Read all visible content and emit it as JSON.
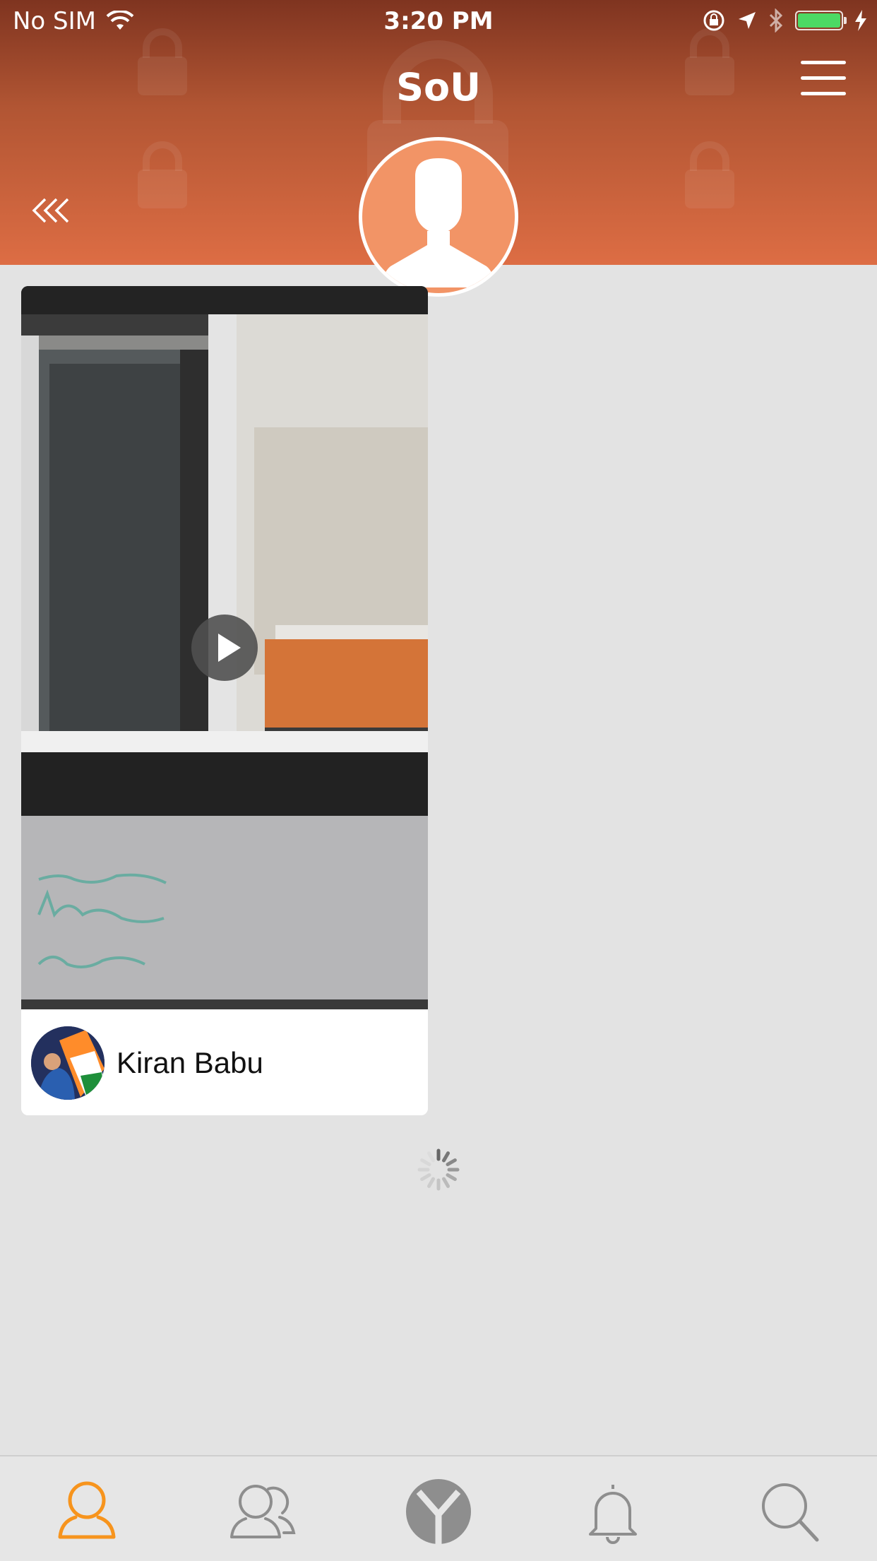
{
  "status_bar": {
    "carrier": "No SIM",
    "time": "3:20 PM",
    "battery_color": "#4cd964"
  },
  "header": {
    "title": "SoU",
    "gradient_colors": [
      "#7f3420",
      "#dd6d44"
    ],
    "back_icon": "double-chevron-left-icon",
    "menu_icon": "hamburger-menu-icon"
  },
  "profile": {
    "avatar_icon": "default-user-silhouette-icon",
    "avatar_color": "#f29466"
  },
  "feed": {
    "items": [
      {
        "media_type": "video",
        "user_name": "Kiran Babu"
      }
    ],
    "loading": true
  },
  "tab_bar": {
    "active_color": "#f7941d",
    "inactive_color": "#8e8e8e",
    "tabs": [
      {
        "icon": "profile-icon",
        "active": true
      },
      {
        "icon": "friends-icon",
        "active": false
      },
      {
        "icon": "app-logo-icon",
        "active": false
      },
      {
        "icon": "bell-icon",
        "active": false
      },
      {
        "icon": "search-icon",
        "active": false
      }
    ]
  }
}
